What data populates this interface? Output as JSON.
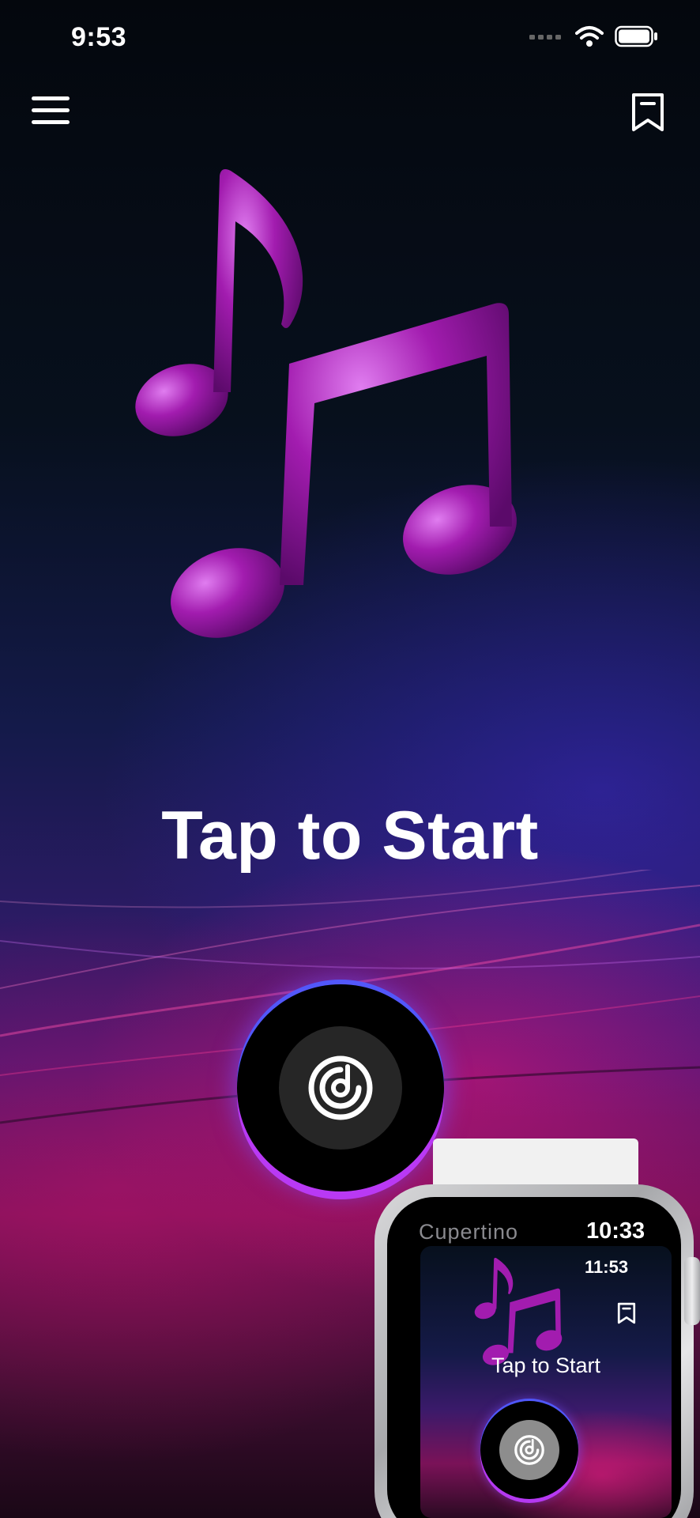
{
  "status_bar": {
    "time": "9:53"
  },
  "header": {
    "menu_icon": "hamburger-menu-icon",
    "bookmark_icon": "bookmark-icon"
  },
  "main": {
    "artwork_icon": "music-notes-icon",
    "cta": "Tap to Start",
    "listen_icon": "shazam-style-listen-icon"
  },
  "watch": {
    "city": "Cupertino",
    "time": "10:33",
    "screen_time": "11:53",
    "screen_cta": "Tap to Start",
    "bookmark_icon": "bookmark-icon"
  },
  "colors": {
    "note_purple": "#a21caf",
    "ring_blue": "#505aff",
    "ring_purple": "#be3cff",
    "accent_pink": "#e61478"
  }
}
